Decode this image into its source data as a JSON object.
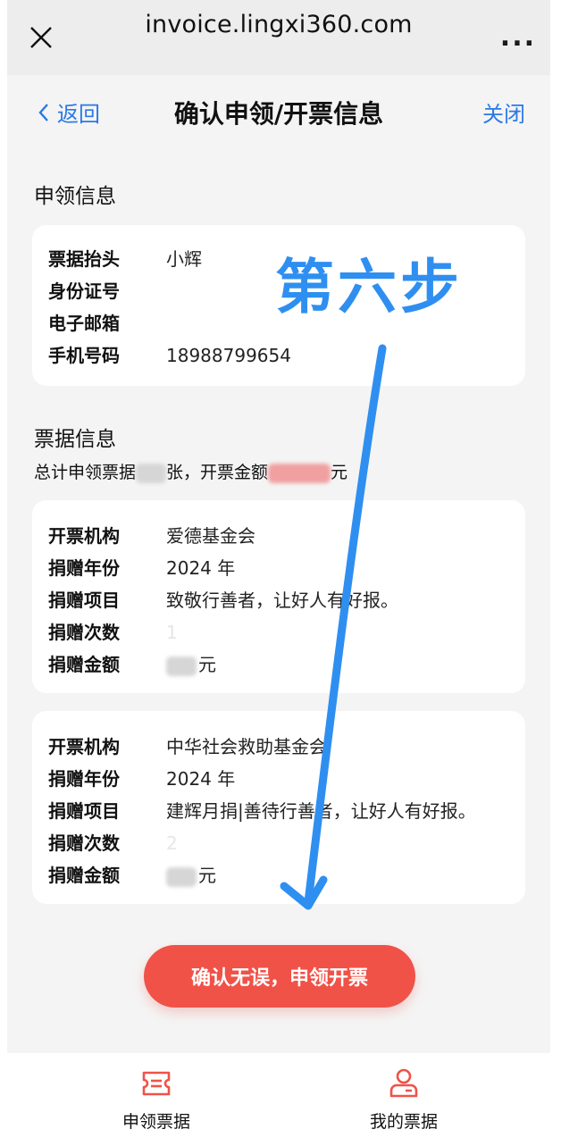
{
  "browser": {
    "url": "invoice.lingxi360.com",
    "close_icon": "close-icon",
    "more_icon": "more-icon",
    "more_glyph": "..."
  },
  "nav": {
    "back_label": "返回",
    "title": "确认申领/开票信息",
    "close_label": "关闭",
    "accent_color": "#2a79e5"
  },
  "apply_info": {
    "section_title": "申领信息",
    "rows": [
      {
        "label": "票据抬头",
        "value": "小辉"
      },
      {
        "label": "身份证号",
        "value": ""
      },
      {
        "label": "电子邮箱",
        "value": ""
      },
      {
        "label": "手机号码",
        "value": "18988799654"
      }
    ]
  },
  "annotation": {
    "text": "第六步",
    "color": "#2f8ff0"
  },
  "invoice_info": {
    "section_title": "票据信息",
    "summary_prefix": "总计申领票据",
    "summary_mid": "张，开票金额",
    "summary_suffix": "元"
  },
  "cards": [
    {
      "rows": [
        {
          "label": "开票机构",
          "value": "爱德基金会"
        },
        {
          "label": "捐赠年份",
          "value": "2024 年"
        },
        {
          "label": "捐赠项目",
          "value": "致敬行善者，让好人有好报。"
        },
        {
          "label": "捐赠次数",
          "value": "1"
        },
        {
          "label": "捐赠金额",
          "value": "元"
        }
      ]
    },
    {
      "rows": [
        {
          "label": "开票机构",
          "value": "中华社会救助基金会"
        },
        {
          "label": "捐赠年份",
          "value": "2024 年"
        },
        {
          "label": "捐赠项目",
          "value": "建辉月捐|善待行善者，让好人有好报。"
        },
        {
          "label": "捐赠次数",
          "value": "2"
        },
        {
          "label": "捐赠金额",
          "value": "元"
        }
      ]
    }
  ],
  "apply_button": {
    "label": "确认无误，申领开票",
    "color": "#f05248"
  },
  "tabs": [
    {
      "label": "申领票据",
      "icon": "ticket-icon",
      "color": "#f05248"
    },
    {
      "label": "我的票据",
      "icon": "user-card-icon",
      "color": "#f05248"
    }
  ]
}
